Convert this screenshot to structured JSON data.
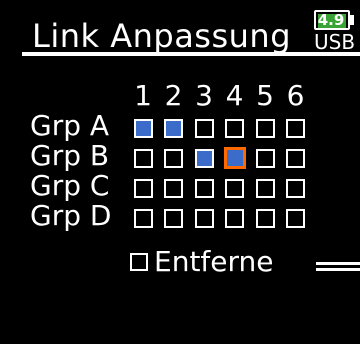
{
  "header": {
    "title": "Link Anpassung",
    "battery_level": "4.9",
    "power_source": "USB",
    "battery_color": "#3aa335"
  },
  "matrix": {
    "columns": [
      "1",
      "2",
      "3",
      "4",
      "5",
      "6"
    ],
    "rows": [
      {
        "label": "Grp A",
        "cells": [
          true,
          true,
          false,
          false,
          false,
          false
        ]
      },
      {
        "label": "Grp B",
        "cells": [
          false,
          false,
          true,
          true,
          false,
          false
        ]
      },
      {
        "label": "Grp C",
        "cells": [
          false,
          false,
          false,
          false,
          false,
          false
        ]
      },
      {
        "label": "Grp D",
        "cells": [
          false,
          false,
          false,
          false,
          false,
          false
        ]
      }
    ],
    "cursor": {
      "row": 1,
      "col": 3
    },
    "on_color": "#3b6cc9",
    "cursor_color": "#ff6a00"
  },
  "remove": {
    "label": "Entferne",
    "checked": false
  }
}
